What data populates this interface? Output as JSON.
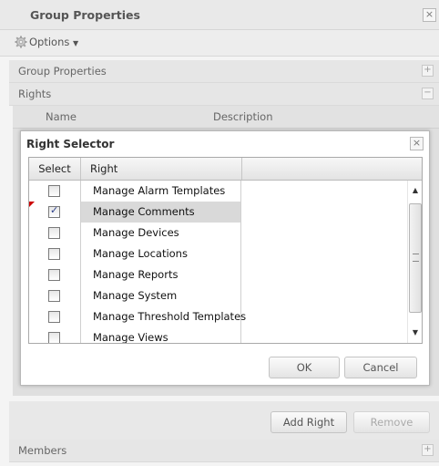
{
  "panel": {
    "title": "Group Properties",
    "options_label": "Options"
  },
  "sections": {
    "group_properties": "Group Properties",
    "rights": "Rights",
    "members": "Members"
  },
  "rights_grid": {
    "col_name": "Name",
    "col_description": "Description",
    "add_label": "Add Right",
    "remove_label": "Remove"
  },
  "dialog": {
    "title": "Right Selector",
    "col_select": "Select",
    "col_right": "Right",
    "rows": [
      {
        "label": "Manage Alarm Templates",
        "checked": false
      },
      {
        "label": "Manage Comments",
        "checked": true
      },
      {
        "label": "Manage Devices",
        "checked": false
      },
      {
        "label": "Manage Locations",
        "checked": false
      },
      {
        "label": "Manage Reports",
        "checked": false
      },
      {
        "label": "Manage System",
        "checked": false
      },
      {
        "label": "Manage Threshold Templates",
        "checked": false
      },
      {
        "label": "Manage Views",
        "checked": false
      }
    ],
    "ok_label": "OK",
    "cancel_label": "Cancel"
  },
  "icons": [
    "close-icon",
    "gear-icon",
    "caret-down-icon",
    "plus-icon",
    "minus-icon",
    "scroll-up-icon",
    "scroll-down-icon"
  ]
}
